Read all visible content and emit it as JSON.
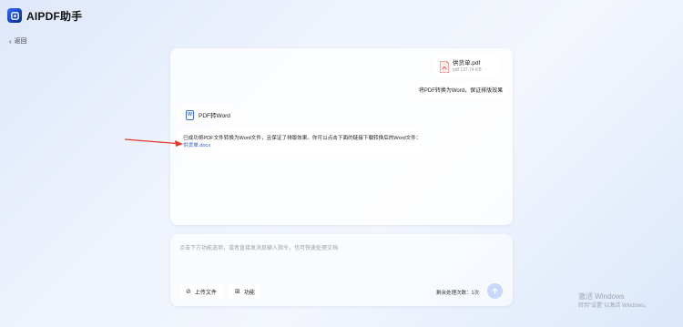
{
  "app": {
    "title": "AIPDF助手"
  },
  "nav": {
    "back_label": "返回"
  },
  "chat": {
    "file": {
      "name": "供货单.pdf",
      "size": "pdf 137.74 KB"
    },
    "user_message": "将PDF转换为Word，保证排版效果",
    "tool": {
      "label": "PDF转Word"
    },
    "bot_message": "已成功将PDF文件转换为Word文件，且保证了排版效果。你可以点击下面的链接下载转换后的Word文件：",
    "download_link": "供货单.docx"
  },
  "composer": {
    "placeholder": "点击下方功能选项，或者直接发消息输入指令，也可快速处理文档",
    "upload_label": "上传文件",
    "function_label": "功能",
    "remaining_label": "剩余处理次数：1次"
  },
  "watermark": {
    "line1": "激活 Windows",
    "line2": "转到\"设置\"以激活 Windows。"
  },
  "colors": {
    "accent": "#2a5bd7",
    "arrow": "#e53a2a",
    "pdf": "#e74c3c",
    "word": "#3b6de0"
  },
  "icons": {
    "logo": "app-logo-icon",
    "back": "chevron-left-icon",
    "pdf": "pdf-file-icon",
    "word": "word-file-icon",
    "upload": "paperclip-icon",
    "function": "grid-icon",
    "send": "arrow-up-icon"
  }
}
